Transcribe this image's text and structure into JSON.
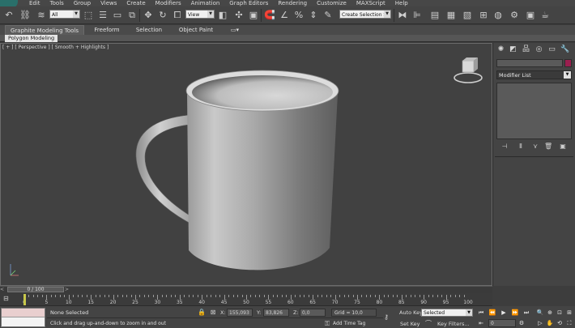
{
  "menu": {
    "items": [
      "Edit",
      "Tools",
      "Group",
      "Views",
      "Create",
      "Modifiers",
      "Animation",
      "Graph Editors",
      "Rendering",
      "Customize",
      "MAXScript",
      "Help"
    ]
  },
  "toolbar": {
    "selection_filter": "All",
    "reference_coord": "View",
    "named_selection": "Create Selection Se"
  },
  "ribbon": {
    "tabs": [
      "Graphite Modeling Tools",
      "Freeform",
      "Selection",
      "Object Paint"
    ],
    "active_panel": "Polygon Modeling"
  },
  "viewport": {
    "label": "[ + ] [ Perspective ] [ Smooth + Highlights ]"
  },
  "command_panel": {
    "modifier_list": "Modifier List",
    "object_color": "#9a1f4f"
  },
  "time_slider": {
    "position": "0 / 100",
    "prev": "<",
    "next": ">"
  },
  "track_bar": {
    "ticks": [
      "0",
      "5",
      "10",
      "15",
      "20",
      "25",
      "30",
      "35",
      "40",
      "45",
      "50",
      "55",
      "60",
      "65",
      "70",
      "75",
      "80",
      "85",
      "90",
      "95",
      "100"
    ]
  },
  "status": {
    "selection": "None Selected",
    "prompt": "Click and drag up-and-down to zoom in and out",
    "x_label": "X:",
    "x_value": "155,093",
    "y_label": "Y:",
    "y_value": "83,826",
    "z_label": "Z:",
    "z_value": "0,0",
    "grid": "Grid = 10,0",
    "add_time_tag": "Add Time Tag",
    "auto_key": "Auto Key",
    "set_key": "Set Key",
    "key_mode": "Selected",
    "key_filters": "Key Filters...",
    "frame": "0"
  }
}
